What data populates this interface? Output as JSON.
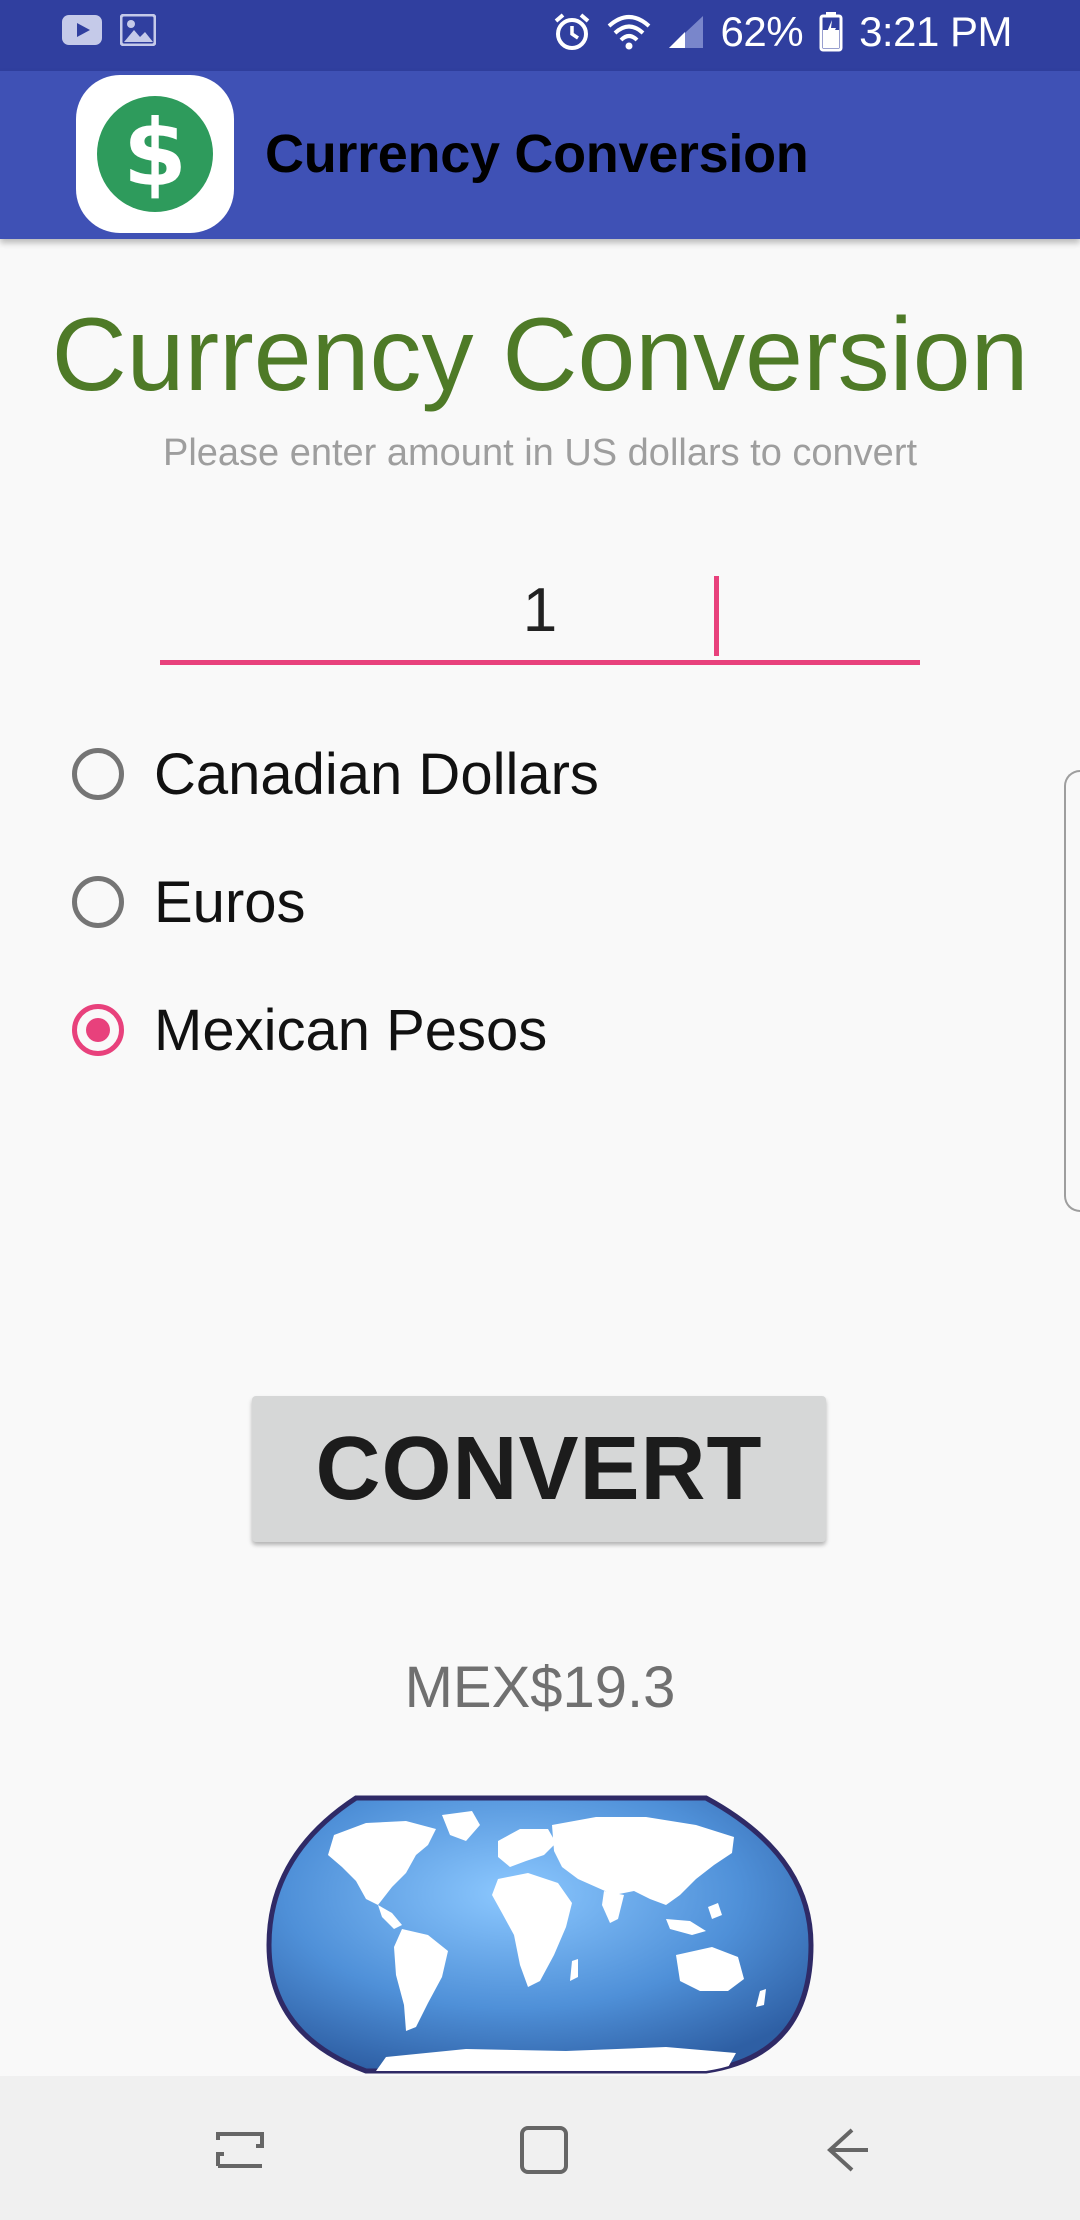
{
  "status_bar": {
    "battery": "62%",
    "time": "3:21 PM",
    "icons": [
      "youtube-icon",
      "image-icon",
      "alarm-icon",
      "wifi-icon",
      "signal-icon",
      "battery-icon"
    ]
  },
  "app_bar": {
    "title": "Currency Conversion",
    "logo_glyph": "$"
  },
  "main": {
    "heading": "Currency Conversion",
    "subheading": "Please enter amount in US dollars to convert",
    "amount_value": "1",
    "radio_options": [
      {
        "label": "Canadian Dollars",
        "checked": false
      },
      {
        "label": "Euros",
        "checked": false
      },
      {
        "label": "Mexican Pesos",
        "checked": true
      }
    ],
    "convert_label": "CONVERT",
    "result": "MEX$19.3"
  },
  "colors": {
    "status_bar": "#303f9f",
    "app_bar": "#3f51b5",
    "heading": "#4e7a27",
    "accent": "#e8417c",
    "logo_coin": "#2e9b5c"
  },
  "nav_bar": {
    "icons": [
      "recent-apps-icon",
      "home-icon",
      "back-icon"
    ]
  }
}
